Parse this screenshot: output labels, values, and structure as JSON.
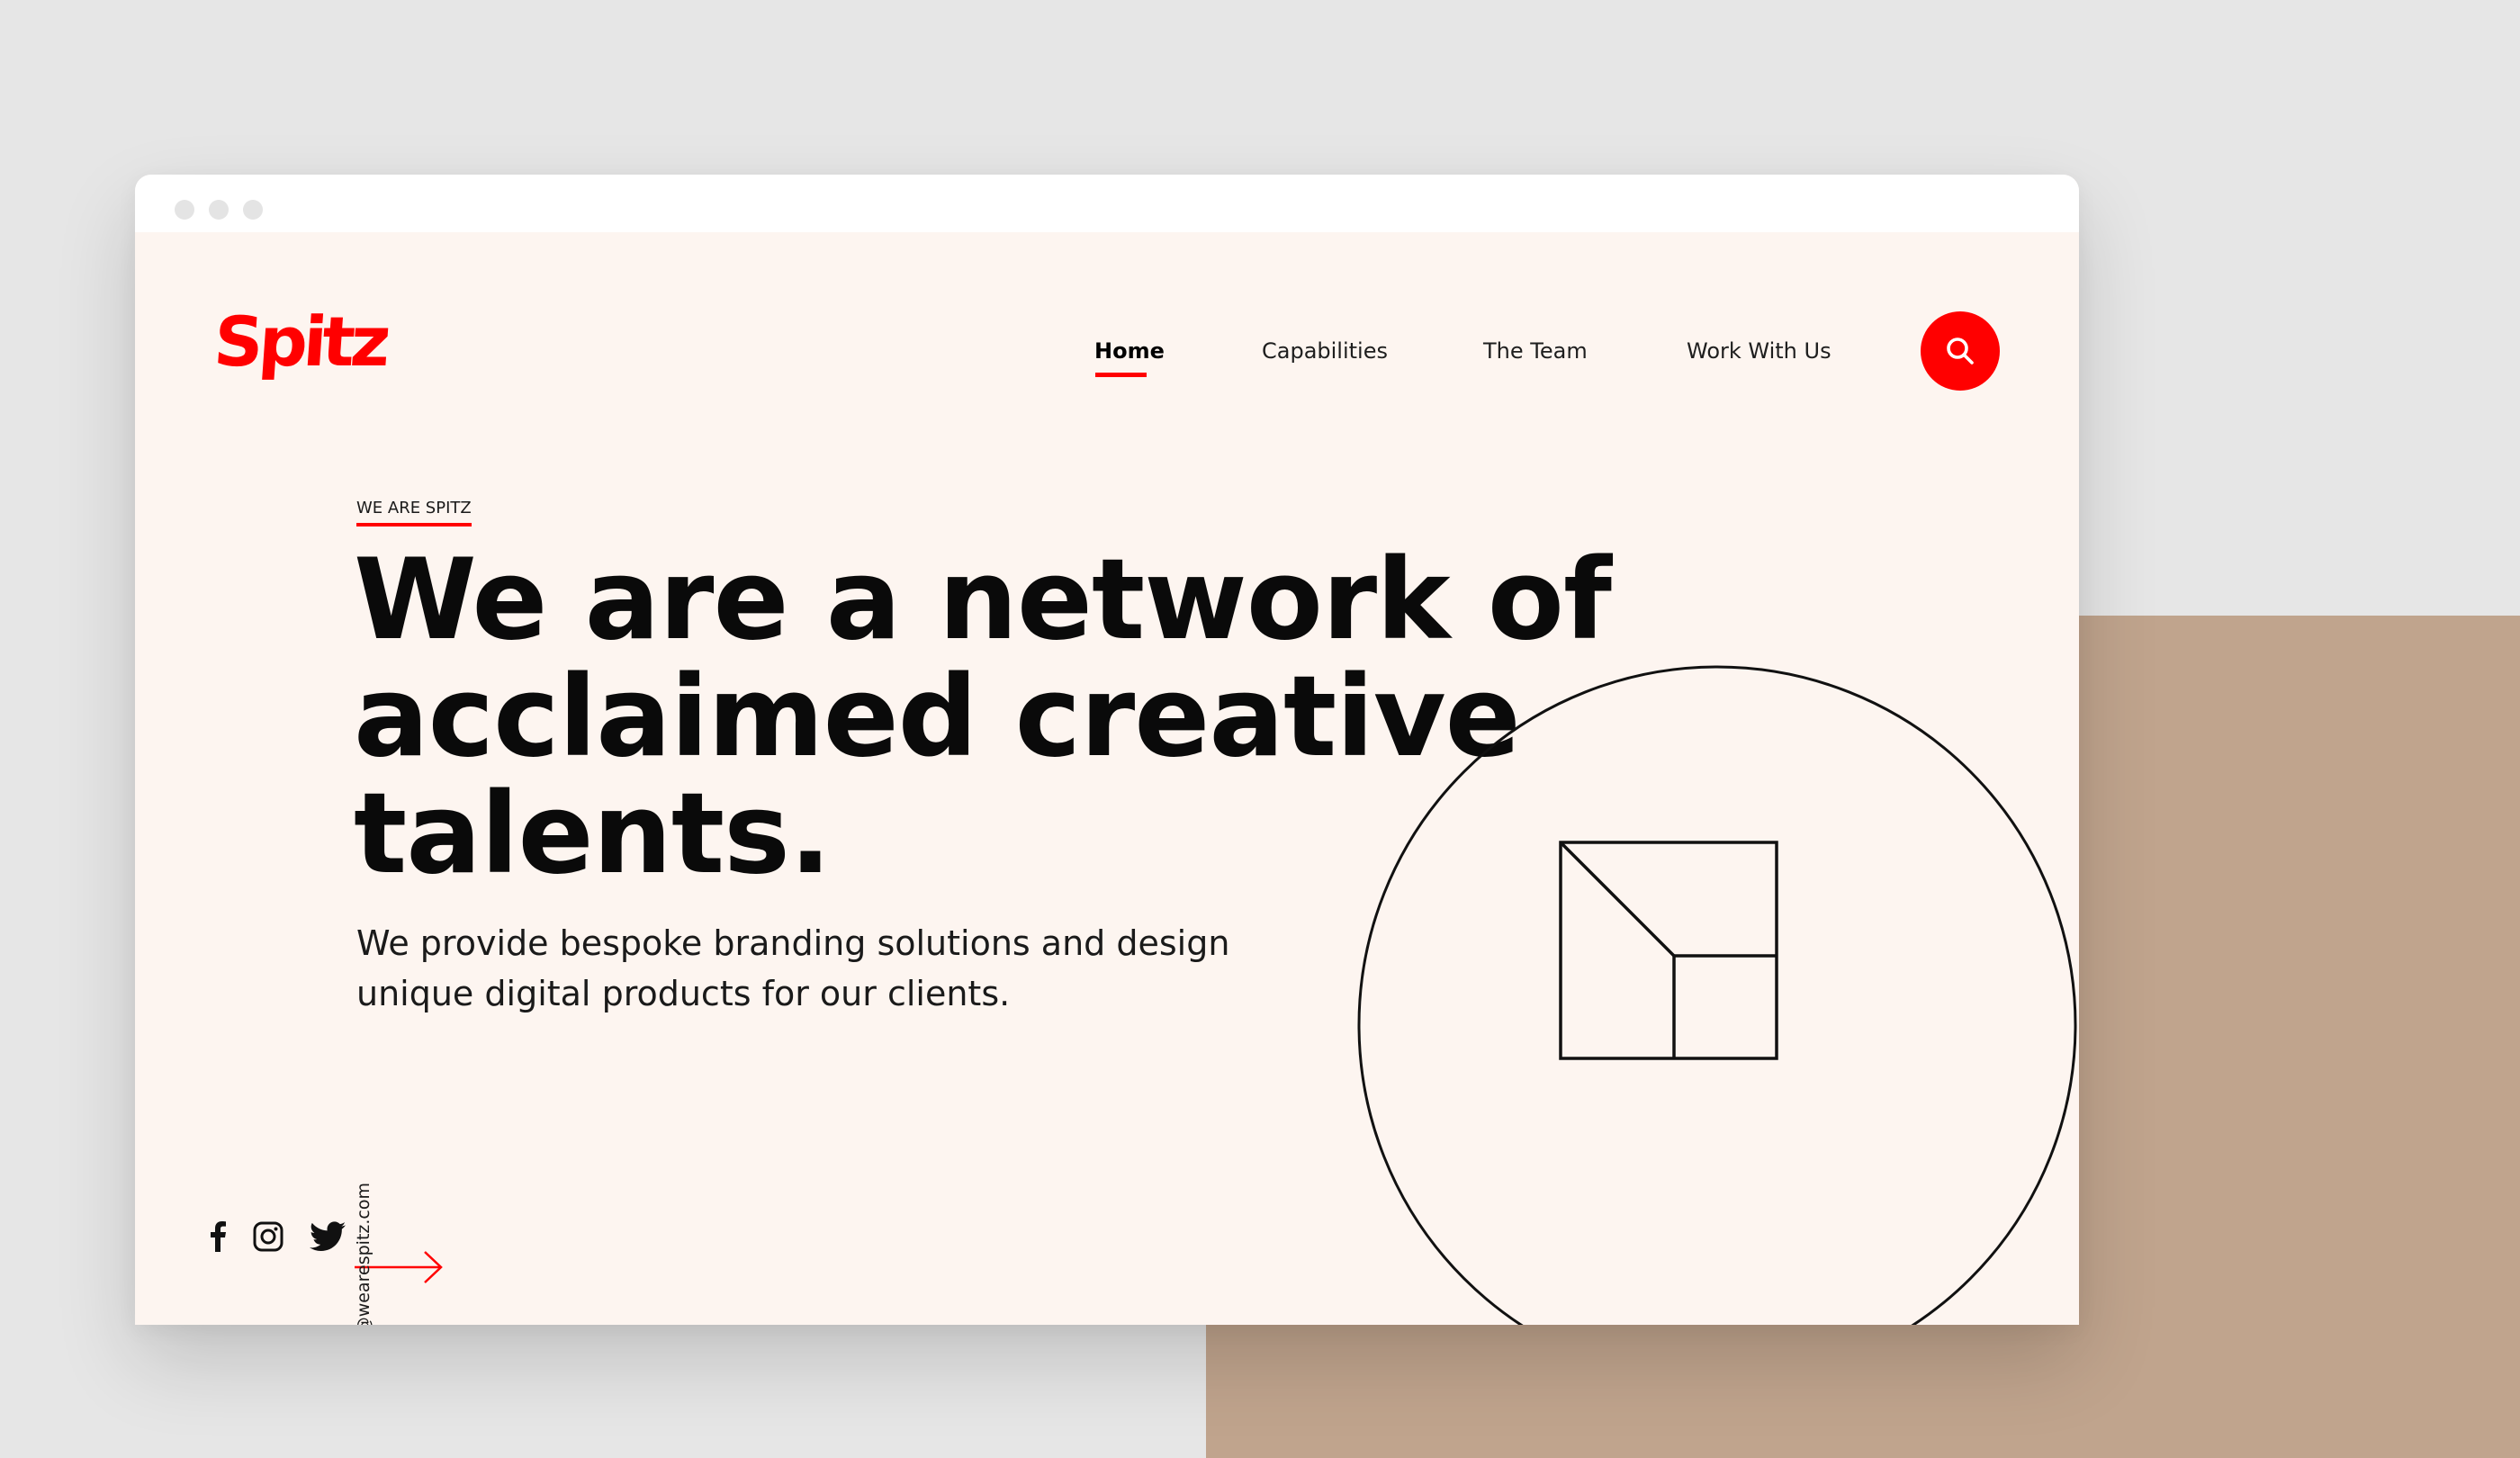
{
  "brand": {
    "name": "Spitz",
    "accent_color": "#ff0000",
    "backdrop_color": "#c0a48d",
    "page_background": "#fdf5f0"
  },
  "nav": {
    "items": [
      {
        "label": "Home",
        "active": true
      },
      {
        "label": "Capabilities",
        "active": false
      },
      {
        "label": "The Team",
        "active": false
      },
      {
        "label": "Work With Us",
        "active": false
      }
    ],
    "search_icon": "search-icon"
  },
  "hero": {
    "eyebrow": "WE ARE SPITZ",
    "headline_lines": [
      "We are a network of",
      "acclaimed creative",
      "talents."
    ],
    "subtext_lines": [
      "We provide bespoke branding solutions and design",
      "unique digital products for our clients."
    ],
    "cta_icon": "arrow-right-icon"
  },
  "contact": {
    "email": "hello@wearespitz.com"
  },
  "social": [
    {
      "name": "facebook",
      "icon": "facebook-icon"
    },
    {
      "name": "instagram",
      "icon": "instagram-icon"
    },
    {
      "name": "twitter",
      "icon": "twitter-icon"
    }
  ],
  "illustration": {
    "icon": "geometric-square-icon"
  }
}
